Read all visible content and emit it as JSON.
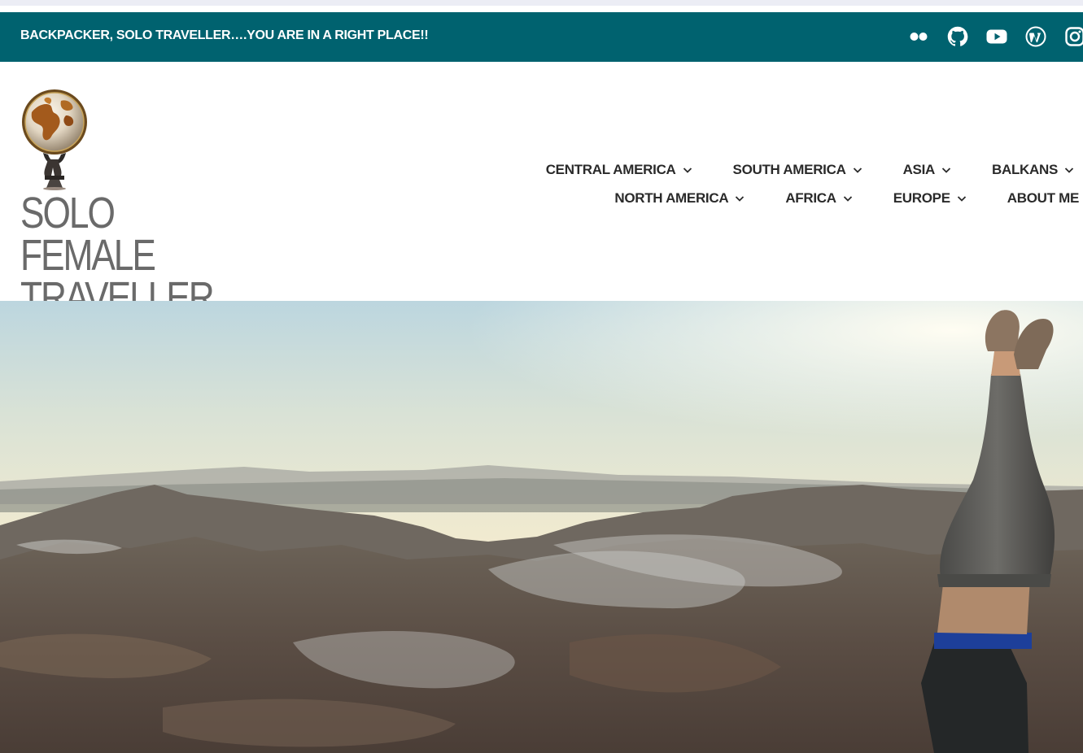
{
  "topbar": {
    "tagline": "BACKPACKER, SOLO TRAVELLER….YOU ARE IN A RIGHT PLACE!!",
    "social_icons": [
      "flickr-icon",
      "github-icon",
      "youtube-icon",
      "wordpress-icon",
      "instagram-icon"
    ]
  },
  "site": {
    "title": "SOLO FEMALE TRAVELLER",
    "logo": "globe-atlas-logo"
  },
  "nav": {
    "row1": [
      {
        "label": "CENTRAL AMERICA",
        "has_dropdown": true
      },
      {
        "label": "SOUTH AMERICA",
        "has_dropdown": true
      },
      {
        "label": "ASIA",
        "has_dropdown": true
      },
      {
        "label": "BALKANS",
        "has_dropdown": true
      }
    ],
    "row2": [
      {
        "label": "NORTH AMERICA",
        "has_dropdown": true
      },
      {
        "label": "AFRICA",
        "has_dropdown": true
      },
      {
        "label": "EUROPE",
        "has_dropdown": true
      },
      {
        "label": "ABOUT ME",
        "has_dropdown": false
      }
    ]
  },
  "colors": {
    "topbar_bg": "#00626f",
    "title": "#6a6a6a",
    "nav_text": "#2a2a2a"
  },
  "hero": {
    "image": "desert-sunset-handstand-photo"
  }
}
